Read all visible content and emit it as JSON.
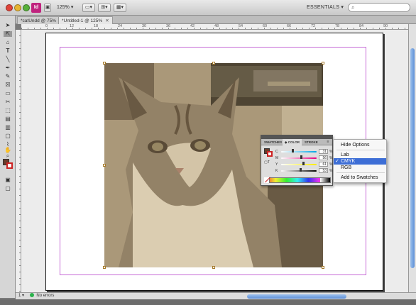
{
  "toolbar": {
    "app_logo": "Id",
    "zoom": "125%",
    "workspace": "ESSENTIALS ▾",
    "search_placeholder": "",
    "icons": [
      "bridge-icon",
      "view-options-icon",
      "screen-mode-icon",
      "arrange-documents-icon"
    ]
  },
  "tabs": [
    {
      "label": "*catUndd @ 75%",
      "close": "✕"
    },
    {
      "label": "*Untitled-1 @ 125%",
      "close": "✕"
    }
  ],
  "ruler_numbers": [
    "0",
    "12",
    "18",
    "24",
    "30",
    "36",
    "42",
    "48",
    "54",
    "60",
    "66",
    "72",
    "78",
    "84",
    "90"
  ],
  "tools": [
    "selection",
    "direct-selection",
    "page",
    "type",
    "line",
    "pen",
    "pencil",
    "rectangle-frame",
    "rectangle",
    "scissors",
    "free-transform",
    "gradient",
    "gradient-feather",
    "note",
    "eyedropper",
    "hand",
    "zoom"
  ],
  "color_panel": {
    "tabs": [
      "SWATCHES",
      "COLOR",
      "STROKE"
    ],
    "active_tab": "COLOR",
    "rows": [
      {
        "label": "C",
        "value": "31",
        "level": 0.31,
        "gradient": [
          "#ffffff",
          "#00a4e4"
        ]
      },
      {
        "label": "M",
        "value": "56",
        "level": 0.56,
        "gradient": [
          "#ffffff",
          "#e5007e"
        ]
      },
      {
        "label": "Y",
        "value": "61",
        "level": 0.61,
        "gradient": [
          "#ffffff",
          "#ffed00"
        ]
      },
      {
        "label": "K",
        "value": "53",
        "level": 0.53,
        "gradient": [
          "#ffffff",
          "#000000"
        ]
      }
    ],
    "unit": "%",
    "fill_color": "#6b3b2a",
    "stroke_color": "#cc2222"
  },
  "menu": {
    "items": [
      {
        "label": "Hide Options",
        "checked": false,
        "selected": false
      },
      {
        "label": "Lab",
        "checked": false,
        "selected": false
      },
      {
        "label": "CMYK",
        "checked": true,
        "selected": true
      },
      {
        "label": "RGB",
        "checked": false,
        "selected": false
      },
      {
        "label": "Add to Swatches",
        "checked": false,
        "selected": false
      }
    ]
  },
  "status": {
    "page": "1",
    "errors": "No errors"
  },
  "colors": {
    "margin_guide": "#c66ad6",
    "selection_accent": "#3d6ed6",
    "frame_handle": "#a67a2a"
  }
}
